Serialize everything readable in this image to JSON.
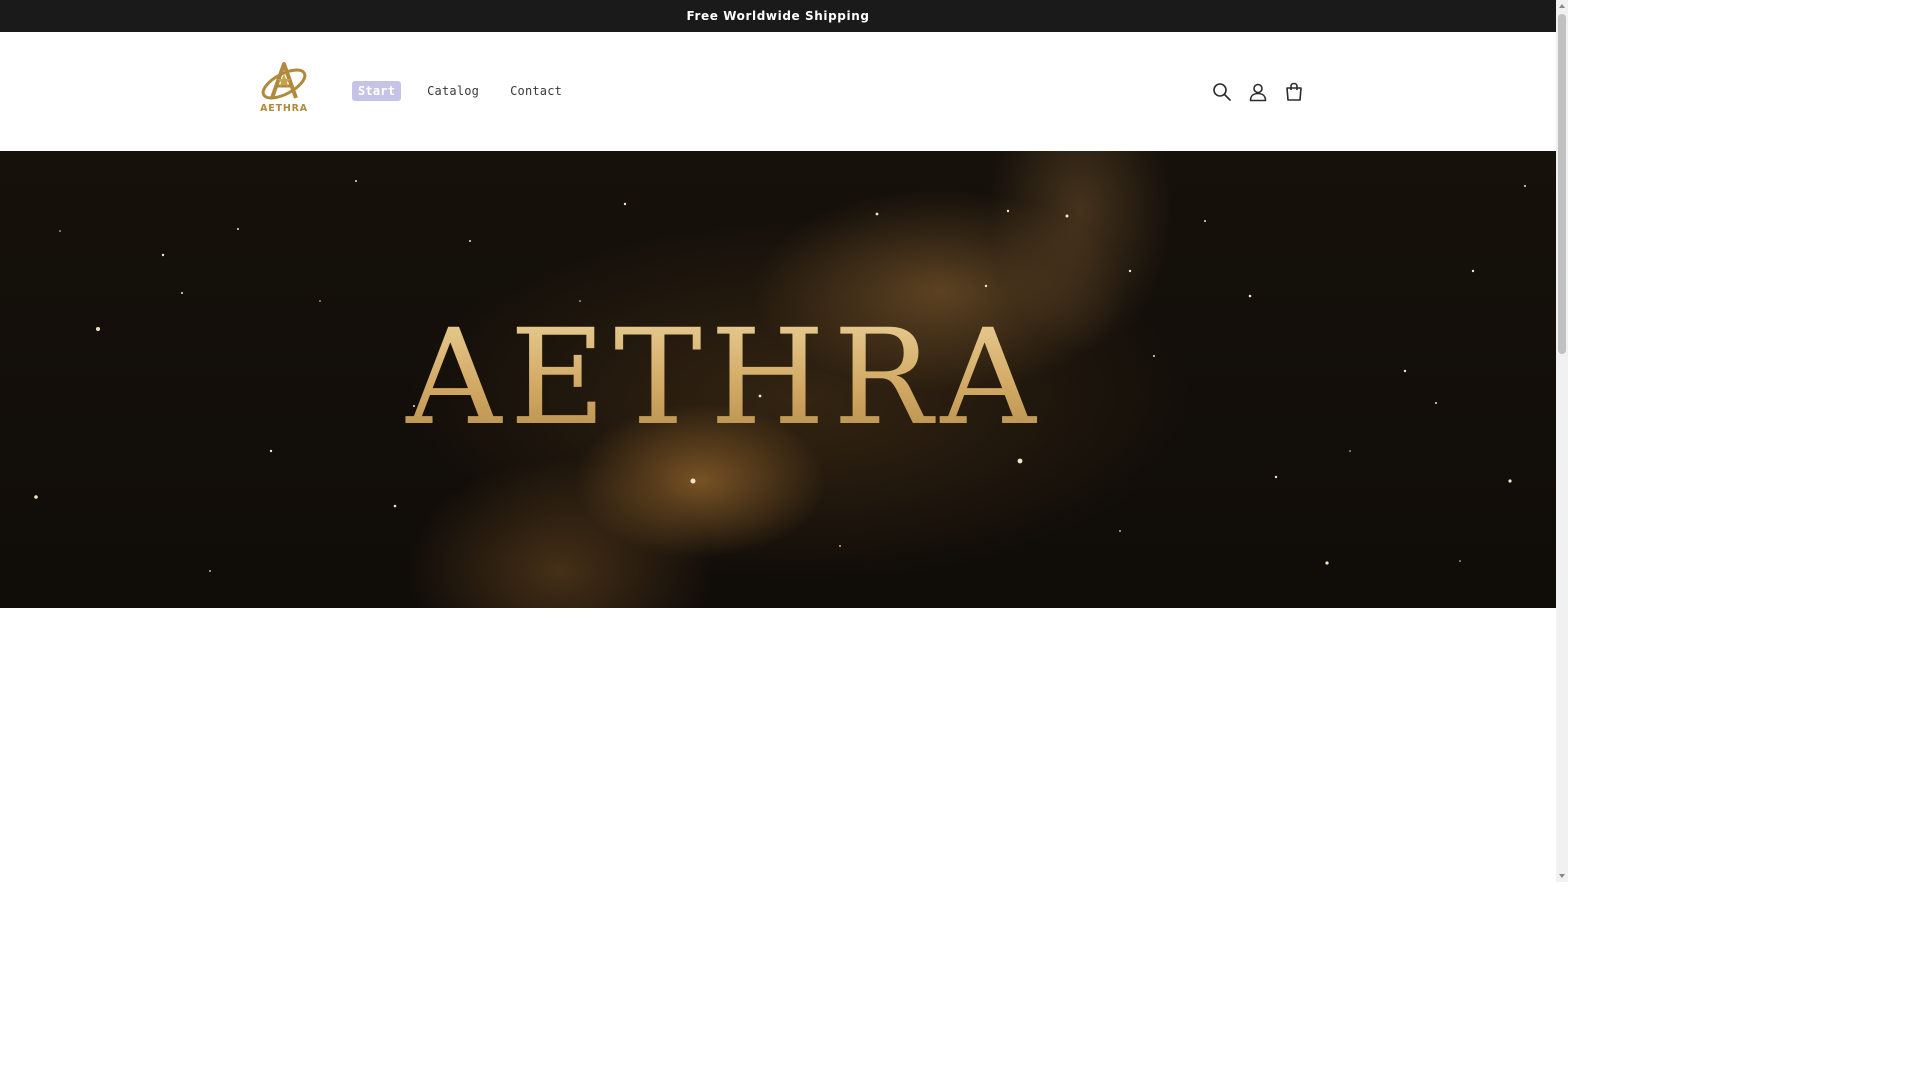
{
  "announcement": {
    "text": "Free Worldwide Shipping"
  },
  "header": {
    "logo": {
      "text": "AETHRA",
      "icon": "aethra-logo-icon",
      "color": "#b08a3a"
    },
    "nav": [
      {
        "label": "Start",
        "active": true
      },
      {
        "label": "Catalog",
        "active": false
      },
      {
        "label": "Contact",
        "active": false
      }
    ],
    "icons": [
      "search-icon",
      "account-icon",
      "cart-icon"
    ],
    "active_tab_color": "#c7c3e6"
  },
  "hero": {
    "title": "AETHRA",
    "title_color": "#d7b26f",
    "background_color": "#100c08"
  }
}
